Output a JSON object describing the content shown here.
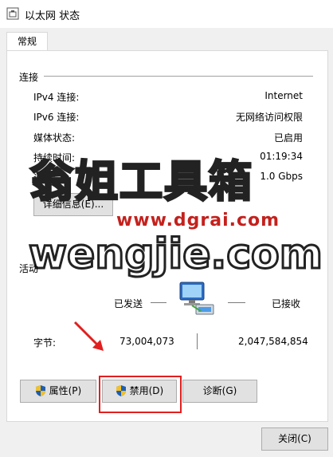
{
  "window": {
    "title": "以太网 状态",
    "title_icon": "ethernet-icon"
  },
  "tabs": [
    {
      "label": "常规"
    }
  ],
  "connection": {
    "section_label": "连接",
    "rows": [
      {
        "label": "IPv4 连接:",
        "value": "Internet"
      },
      {
        "label": "IPv6 连接:",
        "value": "无网络访问权限"
      },
      {
        "label": "媒体状态:",
        "value": "已启用"
      },
      {
        "label": "持续时间:",
        "value": "01:19:34"
      },
      {
        "label": "速度:",
        "value": "1.0 Gbps"
      }
    ],
    "details_button": "详细信息(E)..."
  },
  "activity": {
    "section_label": "活动",
    "sent_label": "已发送",
    "received_label": "已接收",
    "bytes_label": "字节:",
    "bytes_sent": "73,004,073",
    "bytes_received": "2,047,584,854",
    "network_icon": "network-computers-icon"
  },
  "buttons": {
    "properties": "属性(P)",
    "disable": "禁用(D)",
    "diagnose": "诊断(G)",
    "close": "关闭(C)"
  },
  "watermarks": {
    "big_text": "翁姐工具箱",
    "url_text": "www.dgrai.com",
    "brand_text": "wengjie.com"
  },
  "colors": {
    "accent_red": "#e21f1f",
    "shield_blue": "#1e5fb4",
    "shield_yellow": "#f2c02a"
  }
}
